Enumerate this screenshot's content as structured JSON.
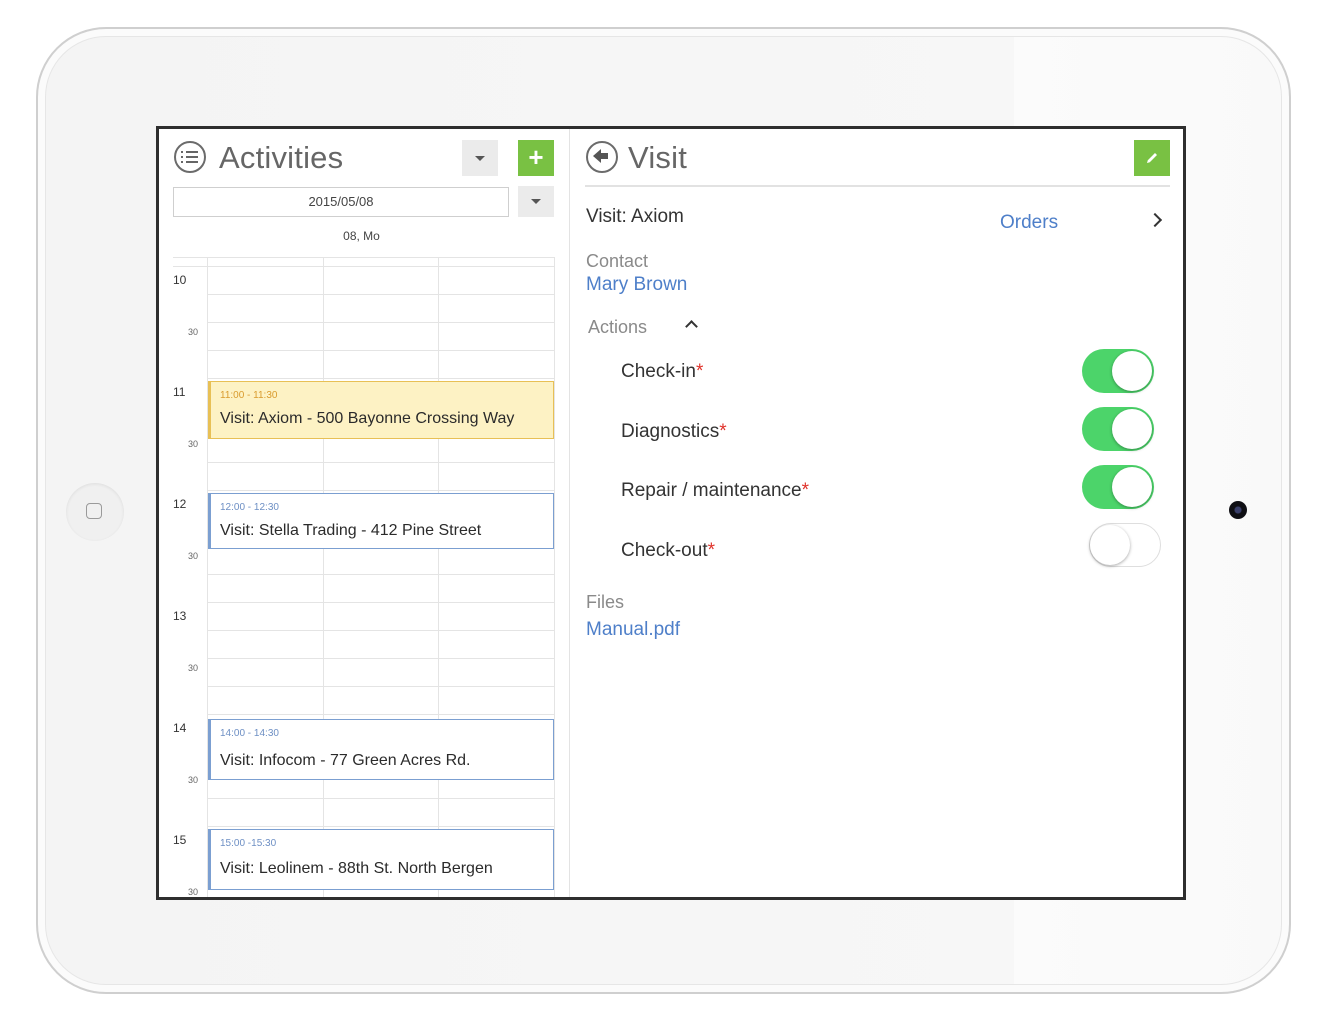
{
  "left_panel": {
    "title": "Activities",
    "add_label": "+",
    "date_value": "2015/05/08",
    "day_label": "08, Mo",
    "hours": [
      "10",
      "11",
      "12",
      "13",
      "14",
      "15"
    ],
    "half_label": "30",
    "events": [
      {
        "time": "11:00 - 11:30",
        "label": "Visit: Axiom - 500 Bayonne Crossing Way",
        "selected": true
      },
      {
        "time": "12:00 - 12:30",
        "label": "Visit: Stella Trading - 412 Pine Street",
        "selected": false
      },
      {
        "time": "14:00 - 14:30",
        "label": "Visit: Infocom - 77 Green Acres Rd.",
        "selected": false
      },
      {
        "time": "15:00 -15:30",
        "label": "Visit: Leolinem - 88th St. North Bergen",
        "selected": false
      }
    ]
  },
  "right_panel": {
    "title": "Visit",
    "visit_name": "Visit: Axiom",
    "orders_label": "Orders",
    "contact_label": "Contact",
    "contact_name": "Mary Brown",
    "actions_label": "Actions",
    "actions": [
      {
        "label": "Check-in",
        "required_mark": "*",
        "enabled": true
      },
      {
        "label": "Diagnostics",
        "required_mark": "*",
        "enabled": true
      },
      {
        "label": "Repair / maintenance",
        "required_mark": "*",
        "enabled": true
      },
      {
        "label": "Check-out",
        "required_mark": "*",
        "enabled": false
      }
    ],
    "files_label": "Files",
    "file_name": "Manual.pdf"
  },
  "colors": {
    "accent_green": "#79c143",
    "toggle_on": "#4cd46a",
    "link_blue": "#4e7fc9",
    "selected_event_bg": "#fdf2c4",
    "required_red": "#e0322a"
  },
  "icons": [
    "list-icon",
    "back-arrow-icon",
    "plus-icon",
    "pencil-icon",
    "chevron-right-icon",
    "chevron-up-icon",
    "dropdown-caret-icon"
  ]
}
